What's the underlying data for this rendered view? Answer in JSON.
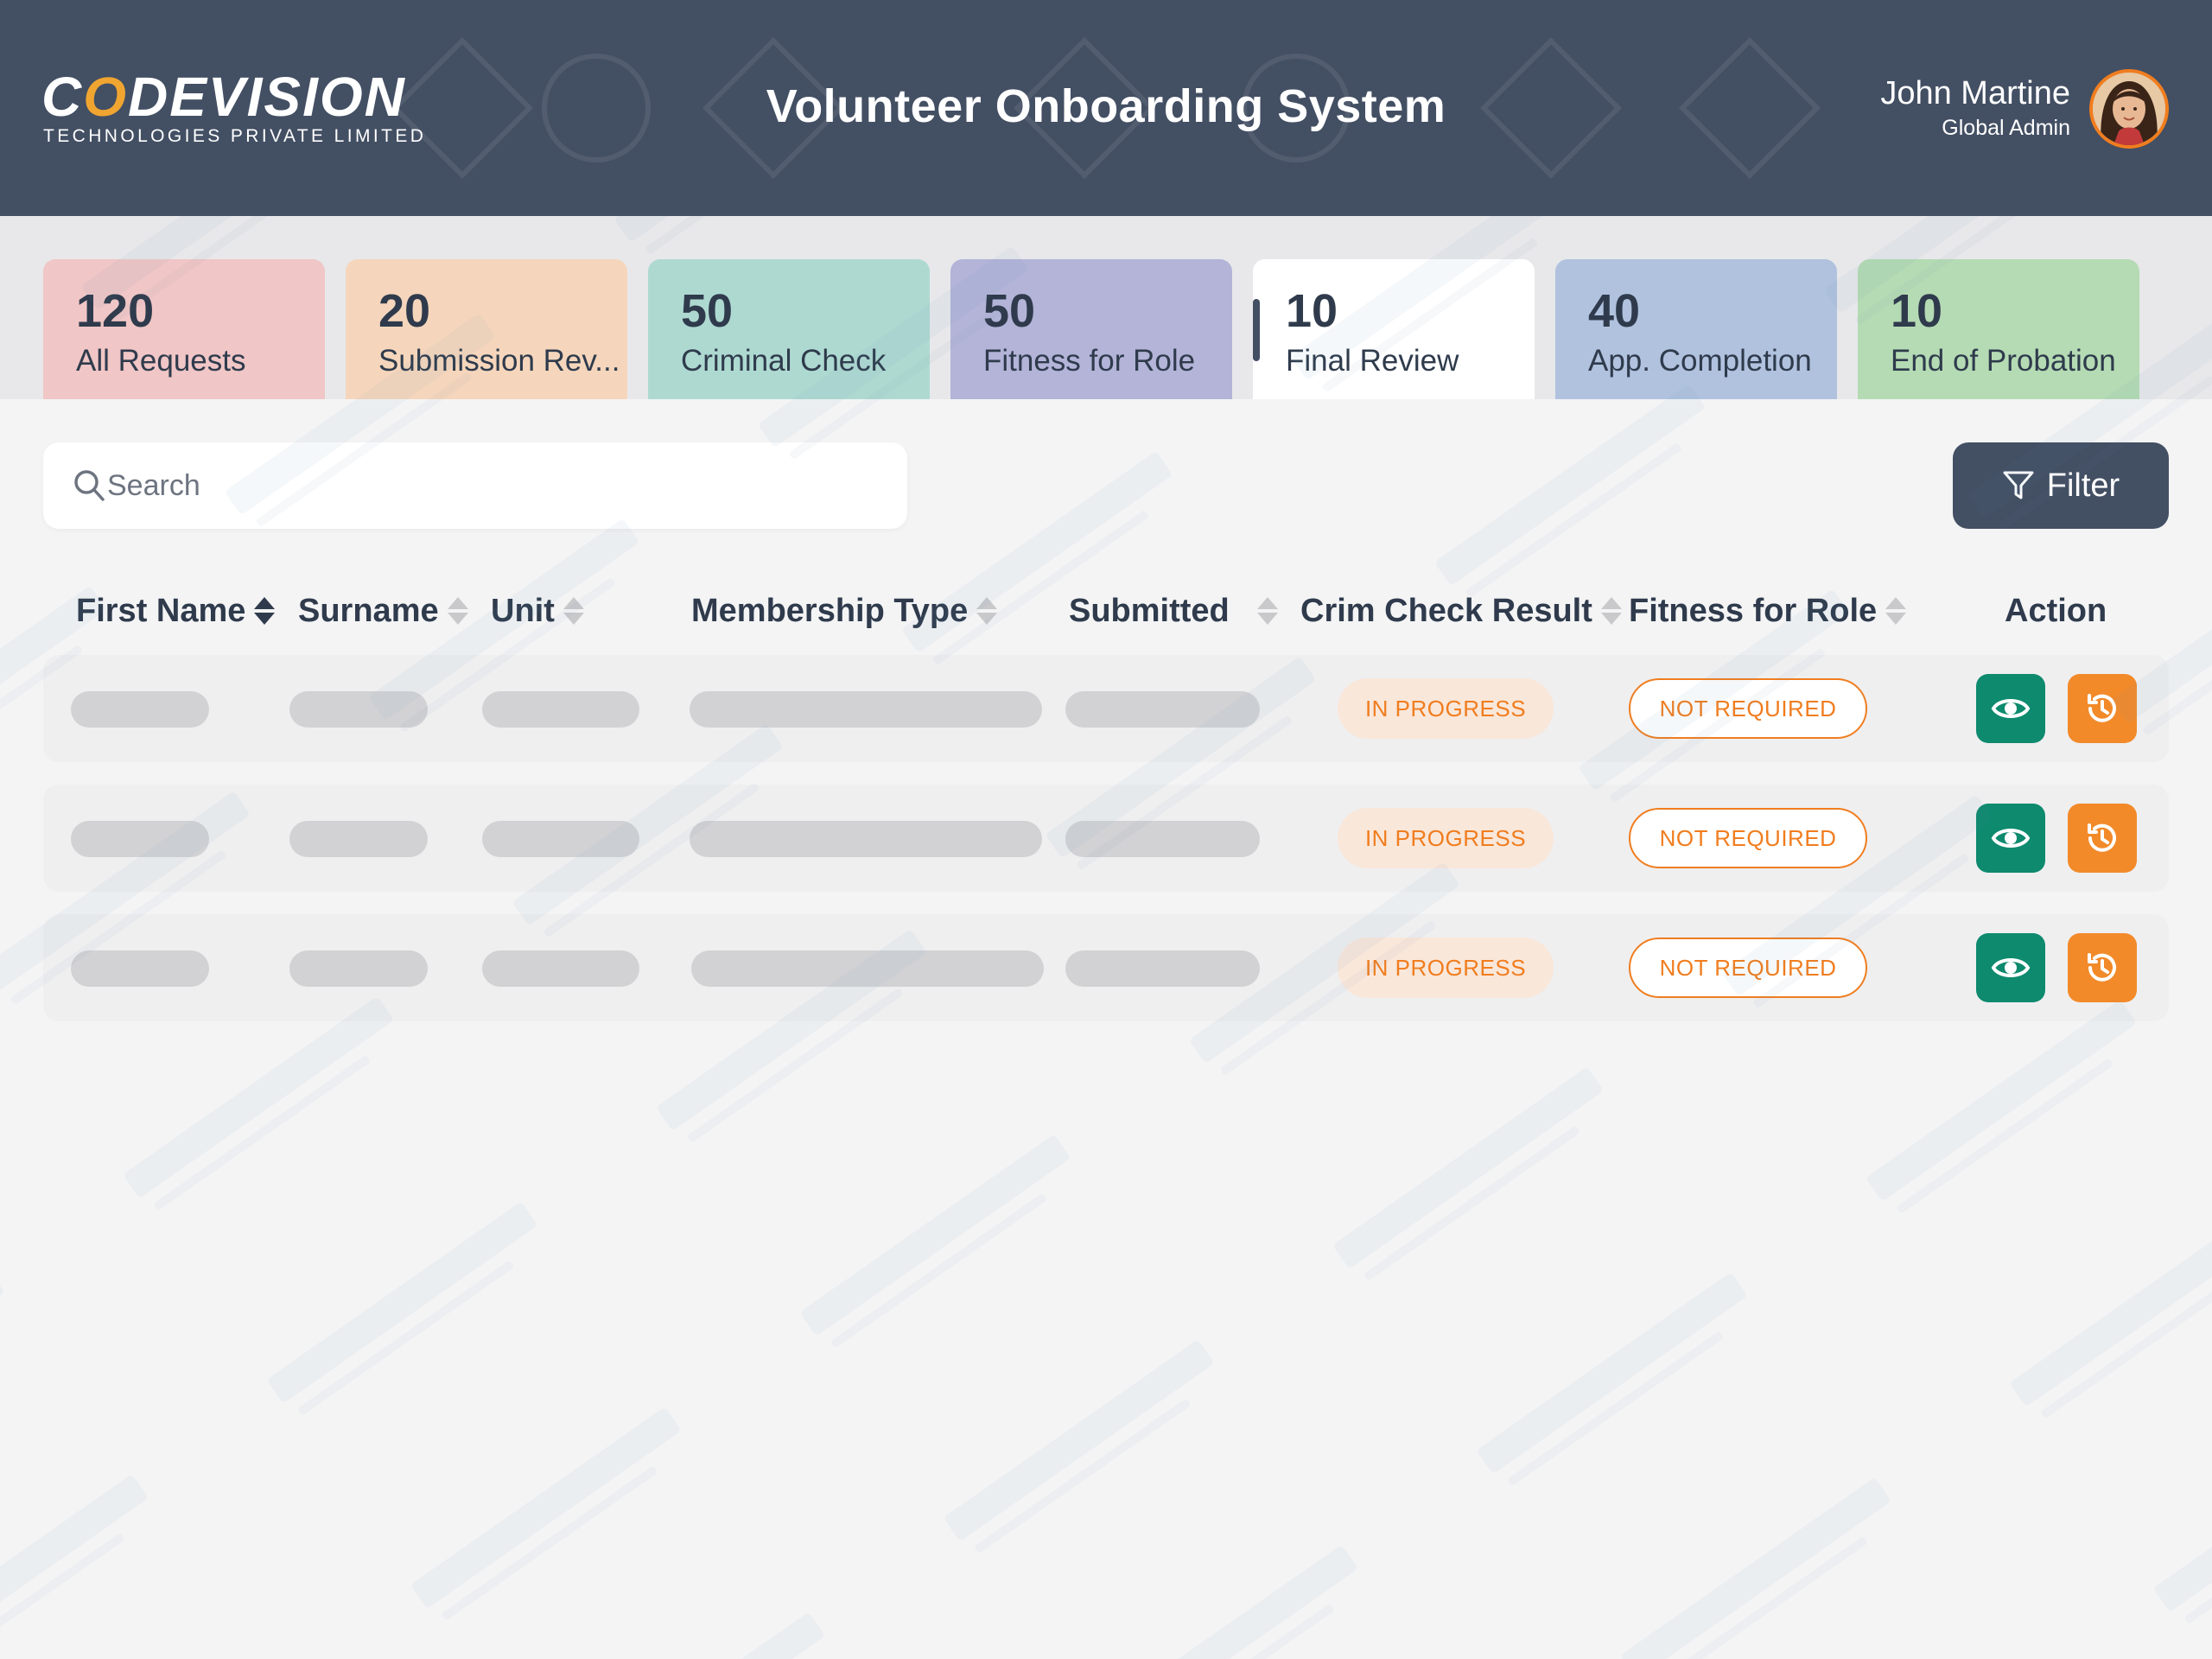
{
  "brand": {
    "logo_text": "CODEVISION",
    "logo_subtitle": "TECHNOLOGIES PRIVATE LIMITED",
    "accent": "#f0a531"
  },
  "header": {
    "title": "Volunteer Onboarding System",
    "background": "#434f63"
  },
  "user": {
    "name": "John Martine",
    "role": "Global Admin"
  },
  "tabs": [
    {
      "count": "120",
      "label": "All Requests",
      "color": "#f0c6c6"
    },
    {
      "count": "20",
      "label": "Submission Rev...",
      "color": "#f5d6bc"
    },
    {
      "count": "50",
      "label": "Criminal Check",
      "color": "#aed9d1"
    },
    {
      "count": "50",
      "label": "Fitness for Role",
      "color": "#b3b4d8"
    },
    {
      "count": "10",
      "label": "Final Review",
      "color": "#ffffff",
      "active": true
    },
    {
      "count": "40",
      "label": "App. Completion",
      "color": "#b0c2de"
    },
    {
      "count": "10",
      "label": "End of Probation",
      "color": "#b5dbb4"
    }
  ],
  "search": {
    "placeholder": "Search",
    "value": ""
  },
  "filter": {
    "label": "Filter"
  },
  "table": {
    "columns": [
      "First Name",
      "Surname",
      "Unit",
      "Membership Type",
      "Submitted",
      "Crim Check Result",
      "Fitness for Role",
      "Action"
    ],
    "rows": [
      {
        "crim_check": "IN PROGRESS",
        "fitness": "NOT REQUIRED"
      },
      {
        "crim_check": "IN PROGRESS",
        "fitness": "NOT REQUIRED"
      },
      {
        "crim_check": "IN PROGRESS",
        "fitness": "NOT REQUIRED"
      }
    ]
  },
  "colors": {
    "in_progress_text": "#f07d1f",
    "view_button": "#0e8a6e",
    "history_button": "#f28a2a"
  },
  "icons": {
    "search": "search-icon",
    "filter": "filter-icon",
    "view": "eye-icon",
    "history": "history-icon",
    "sort": "sort-icon"
  }
}
